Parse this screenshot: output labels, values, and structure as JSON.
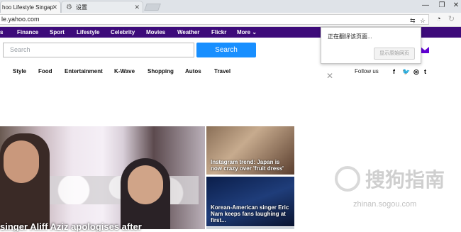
{
  "browser": {
    "tabs": [
      {
        "title": "hoo Lifestyle Singap",
        "active": true
      },
      {
        "title": "设置",
        "active": false
      }
    ],
    "url": "le.yahoo.com",
    "window_controls": {
      "minimize": "—",
      "restore": "❐",
      "close": "✕"
    }
  },
  "navbar": {
    "items": [
      "s",
      "Finance",
      "Sport",
      "Lifestyle",
      "Celebrity",
      "Movies",
      "Weather",
      "Flickr",
      "More ⌄"
    ],
    "color": "#3d0b7a"
  },
  "search": {
    "placeholder": "Search",
    "button_label": "Search",
    "button_color": "#188fff"
  },
  "subnav": {
    "items": [
      "Style",
      "Food",
      "Entertainment",
      "K-Wave",
      "Shopping",
      "Autos",
      "Travel"
    ],
    "follow_label": "Follow us",
    "social_icons": [
      "f",
      "t",
      "◎",
      "t"
    ]
  },
  "translate_popup": {
    "message": "正在翻译该页面...",
    "button_label": "显示原始网页"
  },
  "hero": {
    "headline": "singer Aliff Aziz apologises after"
  },
  "cards": [
    {
      "title": "Instagram trend: Japan is now crazy over 'fruit dress'"
    },
    {
      "title": "Korean-American singer Eric Nam keeps fans laughing at first..."
    }
  ],
  "watermark": {
    "text": "搜狗指南",
    "sub": "zhinan.sogou.com"
  }
}
